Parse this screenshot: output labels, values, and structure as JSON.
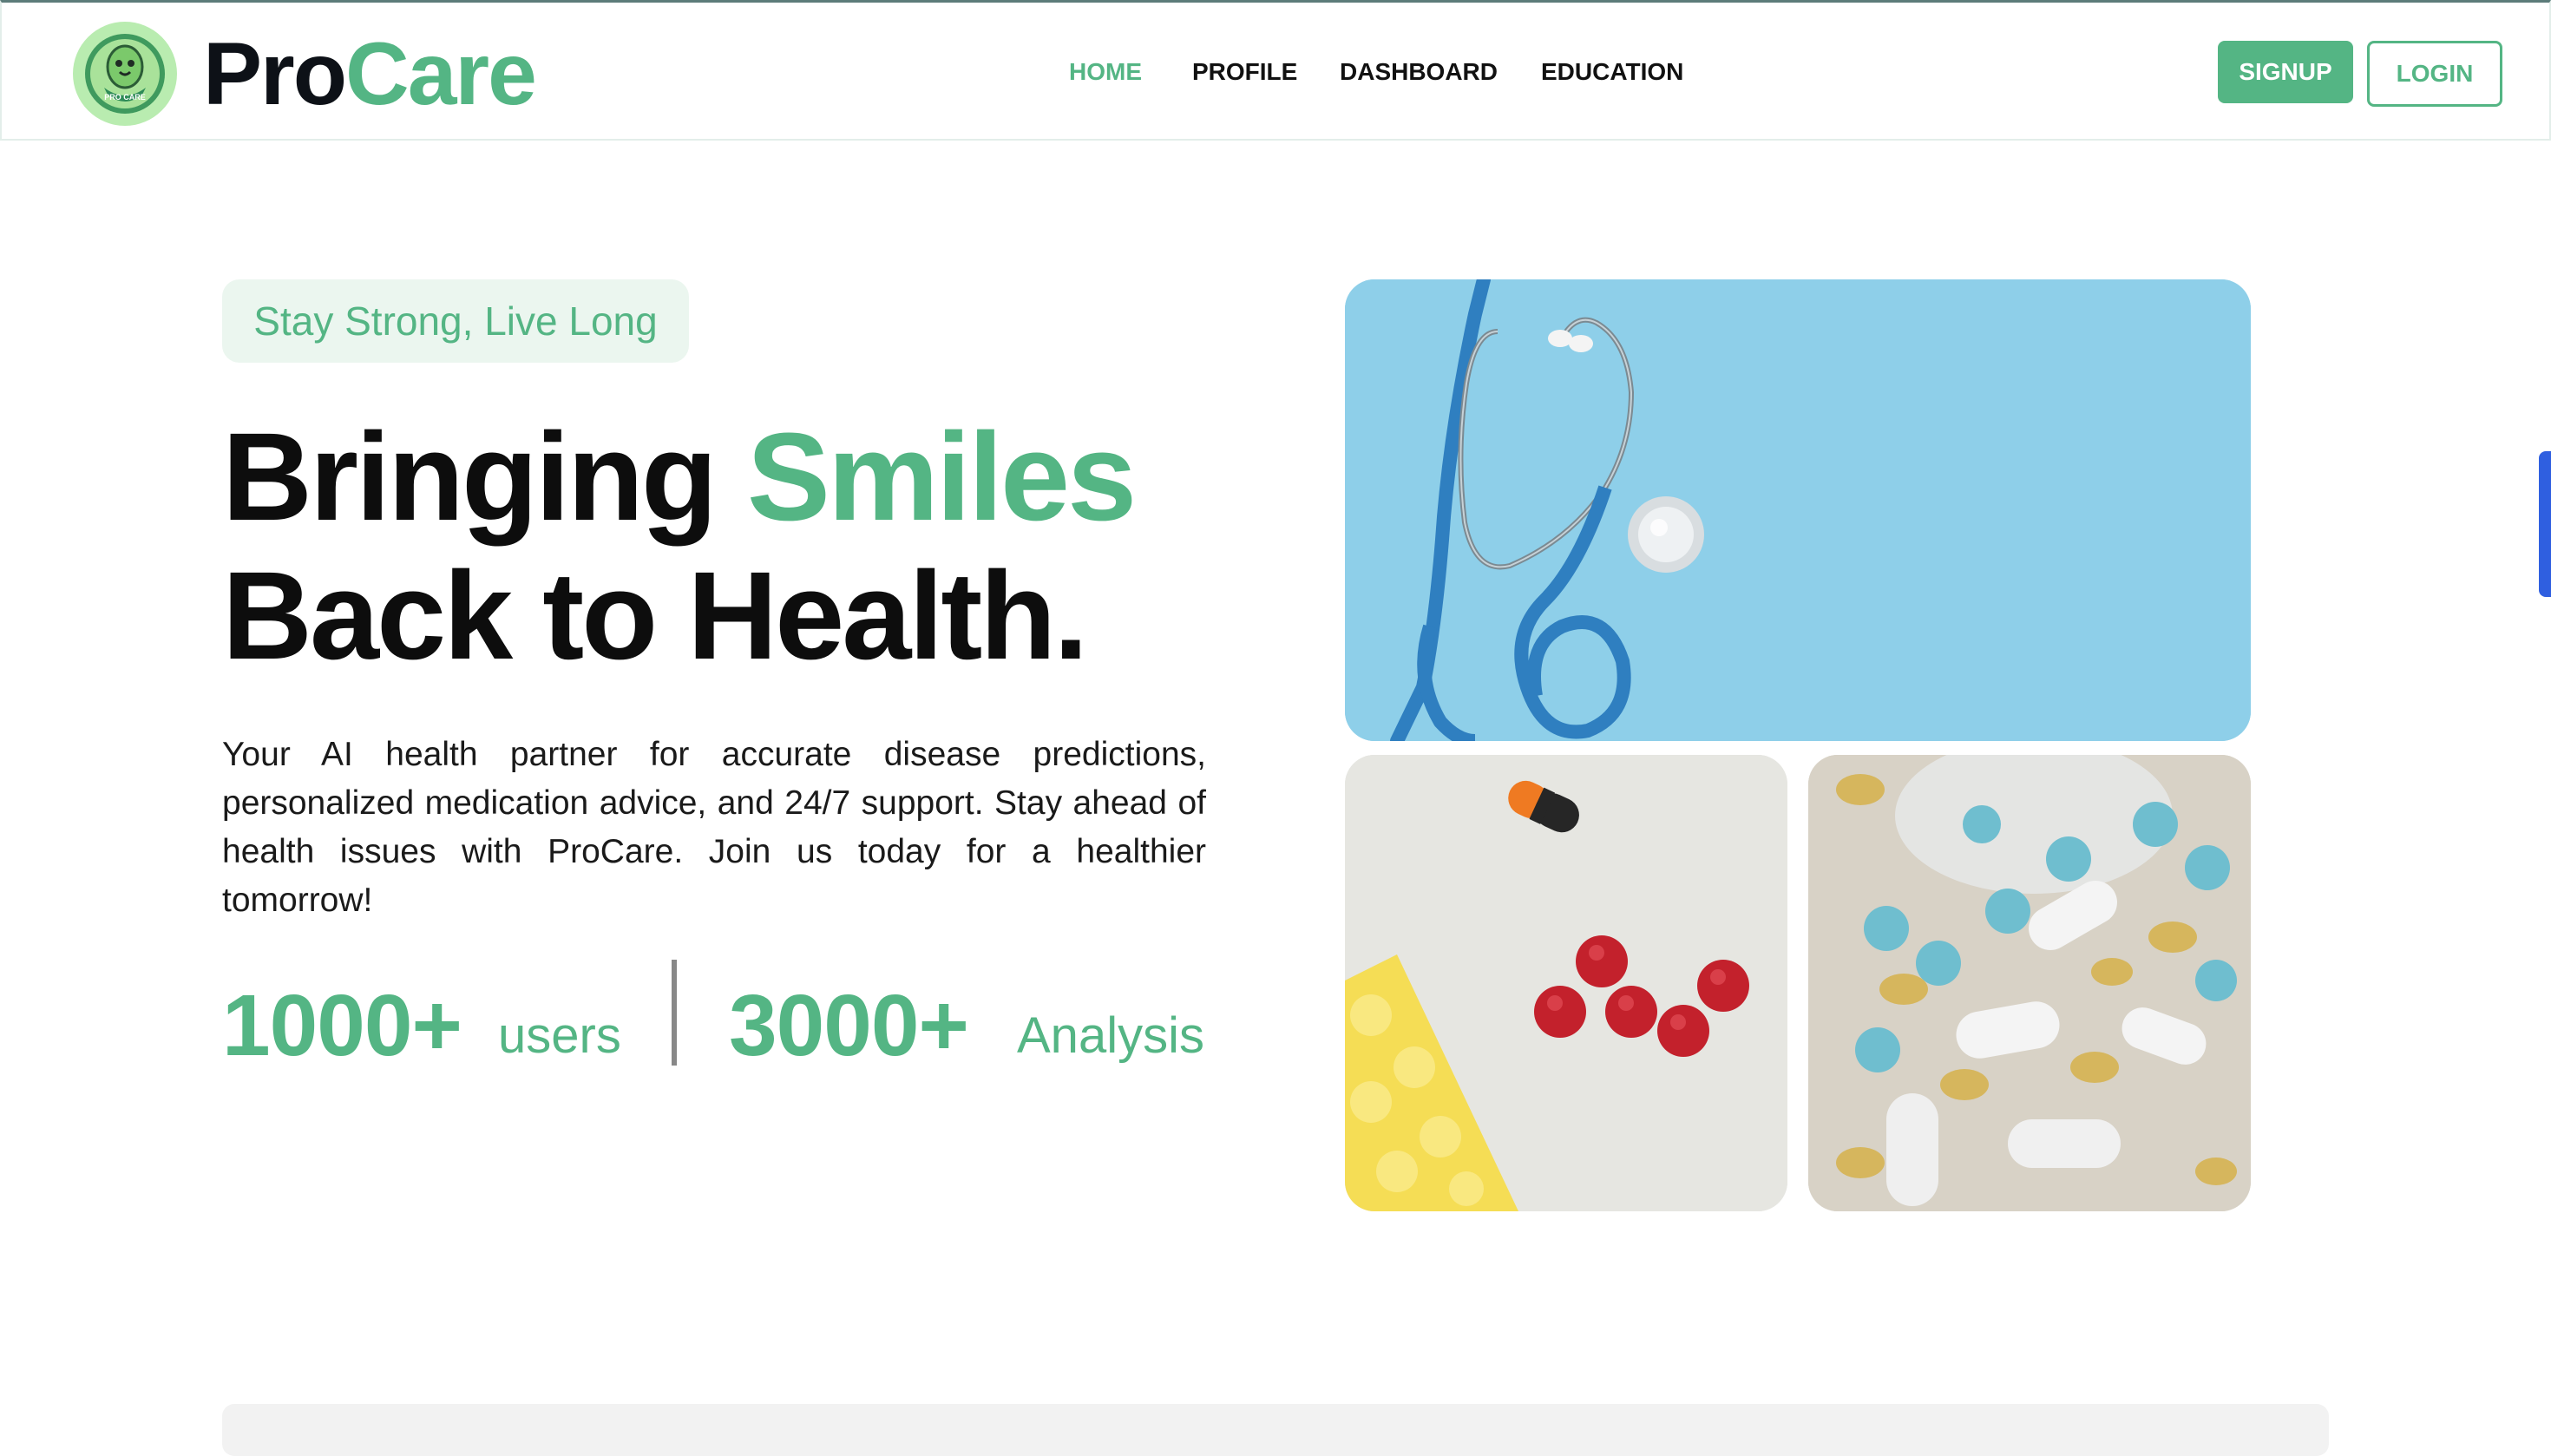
{
  "brand": {
    "name_part1": "Pro",
    "name_part2": "Care",
    "logo_icon": "procare-mascot-logo-icon",
    "logo_text": "PRO CARE"
  },
  "nav": {
    "items": [
      "HOME",
      "PROFILE",
      "DASHBOARD",
      "EDUCATION"
    ],
    "active": "HOME"
  },
  "auth": {
    "signup_label": "SIGNUP",
    "login_label": "LOGIN"
  },
  "hero": {
    "tagline": "Stay Strong, Live Long",
    "headline_part1": "Bringing ",
    "headline_accent": "Smiles",
    "headline_line2": "Back to Health.",
    "description": "Your AI health partner for accurate disease predictions, personalized medication advice, and 24/7 support. Stay ahead of health issues with ProCare. Join us today for a healthier tomorrow!",
    "stats": [
      {
        "number": "1000+",
        "label": "users"
      },
      {
        "number": "3000+",
        "label": "Analysis"
      }
    ],
    "images": [
      "stethoscope-image",
      "red-pills-image",
      "assorted-pills-image"
    ]
  },
  "colors": {
    "accent": "#54b584",
    "tagline_bg": "#ebf6ef",
    "text": "#0d1117",
    "steth_bg": "#8ecfe9"
  }
}
